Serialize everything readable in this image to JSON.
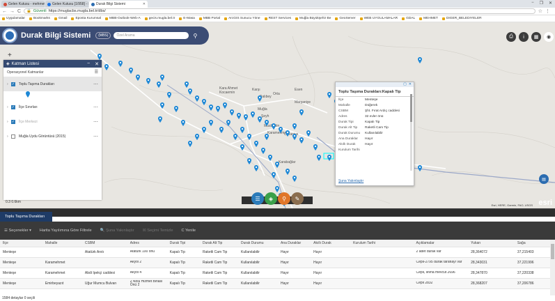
{
  "browser": {
    "tabs": [
      {
        "label": "Gelen Kutusu - mehmet",
        "icon_color": "#d14836",
        "active": false
      },
      {
        "label": "Gelen Kutusu [1/958] - I",
        "icon_color": "#1a73e8",
        "active": false
      },
      {
        "label": "Durak Bilgi Sistemi",
        "icon_color": "#2b6cb0",
        "active": true
      }
    ],
    "window_controls": [
      "−",
      "❐",
      "✕"
    ],
    "security_label": "Güvenli",
    "url": "https://muglacbs.mugla.bel.tr/dbs/",
    "bookmarks": [
      "Uygulamalar",
      "Bookmarks",
      "Gmail",
      "Eposta Kurumsal",
      "MBB-Outlook-Web-A",
      "gecis.mugla.bel.tr",
      "E-Masa",
      "MBB Portal",
      "ArcGIS Sunucu Yöne",
      "REST Services",
      "Muğla Büyükşehir Be",
      "GeoServer",
      "WEB UYGULAMALAR",
      "GDAL",
      "MEHMET",
      "DIGER_BELEDIYELER"
    ]
  },
  "app": {
    "title": "Durak Bilgi Sistemi",
    "badge": "(MBS)",
    "search_placeholder": "Özel Arama"
  },
  "map_labels": [
    "Kara Ahmet",
    "Kocaemin",
    "Karşı",
    "Balıbey",
    "Orta",
    "Muğla",
    "Muslihittin",
    "Karamehmet",
    "Orhaniye",
    "Karabağlar",
    "Marşaniye",
    "Esen",
    "Şeyh"
  ],
  "layer_panel": {
    "title": "Katman Listesi",
    "subtitle": "Operasyonel Katmanlar",
    "layers": [
      {
        "name": "Toplu Taşıma Durakları",
        "checked": true,
        "selected": true,
        "dimmed": false
      },
      {
        "name": "İlçe Sınırları",
        "checked": true,
        "selected": false,
        "dimmed": false
      },
      {
        "name": "İlçe Merkezi",
        "checked": true,
        "selected": false,
        "dimmed": true
      },
      {
        "name": "Muğla Uydu Görüntüsü (2015)",
        "checked": false,
        "selected": false,
        "dimmed": false
      }
    ]
  },
  "popup": {
    "title": "Toplu Taşıma Durakları:Kapalı Tip",
    "rows": [
      {
        "k": "İlçe",
        "v": "Menteşe"
      },
      {
        "k": "Mahalle",
        "v": "Düğerek"
      },
      {
        "k": "CSBM",
        "v": "Şht. Fırat Ardıç caddesi"
      },
      {
        "k": "Adres",
        "v": "32 evler önü"
      },
      {
        "k": "Durak Tipi",
        "v": "Kapalı Tip"
      },
      {
        "k": "Durak Alt Tip",
        "v": "Raketli Cam Tip"
      },
      {
        "k": "Durak Durumu",
        "v": "Kullanılabilir"
      },
      {
        "k": "Ana Duraklar",
        "v": "Hayır"
      },
      {
        "k": "Akıllı Durak",
        "v": "Hayır"
      },
      {
        "k": "Kurulum Tarihi",
        "v": ""
      }
    ],
    "link": "Şuna Yakınlaştır"
  },
  "map_footer": {
    "attribution": "Esri, HERE, Garmin, FAO, USGS",
    "brand": "esri",
    "scale": "0.3     0.6km"
  },
  "table": {
    "tab": "Toplu Taşıma Durakları",
    "tools": [
      "☰ Seçenekler ▾",
      "Harita Yayılımına Göre Filtrele",
      "🔍 Şuna Yakınlaştır",
      "☒ Seçimi Temizle",
      "C Yenile"
    ],
    "columns": [
      "İlçe",
      "Mahalle",
      "CSBM",
      "Adres",
      "Durak Tipi",
      "Durak Alt Tip",
      "Durak Durumu",
      "Ana Duraklar",
      "Akıllı Durak",
      "Kurulum Tarihi",
      "Açıklamalar",
      "Yukarı",
      "Sağa"
    ],
    "rows": [
      [
        "Menteşe",
        "",
        "Atatürk Anıtı",
        "Atatürk 100 önü",
        "Kapalı Tip",
        "Raketli Cam Tip",
        "Kullanılabilir",
        "Hayır",
        "Hayır",
        "",
        "2 adet durak var",
        "28,364072",
        "37,215403"
      ],
      [
        "Menteşe",
        "Karamehmet",
        "",
        "Akyol 2",
        "Kapalı Tip",
        "Raketli Cam Tip",
        "Kullanılabilir",
        "Hayır",
        "Hayır",
        "",
        "Cepli-2795 durak tarafıayı var",
        "28,343031",
        "37,221996"
      ],
      [
        "Menteşe",
        "Karamehmet",
        "Abdi İpekçi caddesi",
        "Akyol 4",
        "Kapalı Tip",
        "Raketli Cam Tip",
        "Kullanılabilir",
        "Hayır",
        "Hayır",
        "",
        "Cepli, levha mevcut 2696",
        "28,347870",
        "37,220338"
      ],
      [
        "Menteşe",
        "Emirbeyazıt",
        "Uğur Mumcu Bulvarı",
        "2 Nolu Hizmet Binası Önü 2",
        "Kapalı Tip",
        "Raketli Cam Tip",
        "Kullanılabilir",
        "Hayır",
        "Hayır",
        "",
        "Cepli 2832",
        "28,368207",
        "37,206786"
      ]
    ]
  },
  "status": "1584 detaylar   0 seçili"
}
